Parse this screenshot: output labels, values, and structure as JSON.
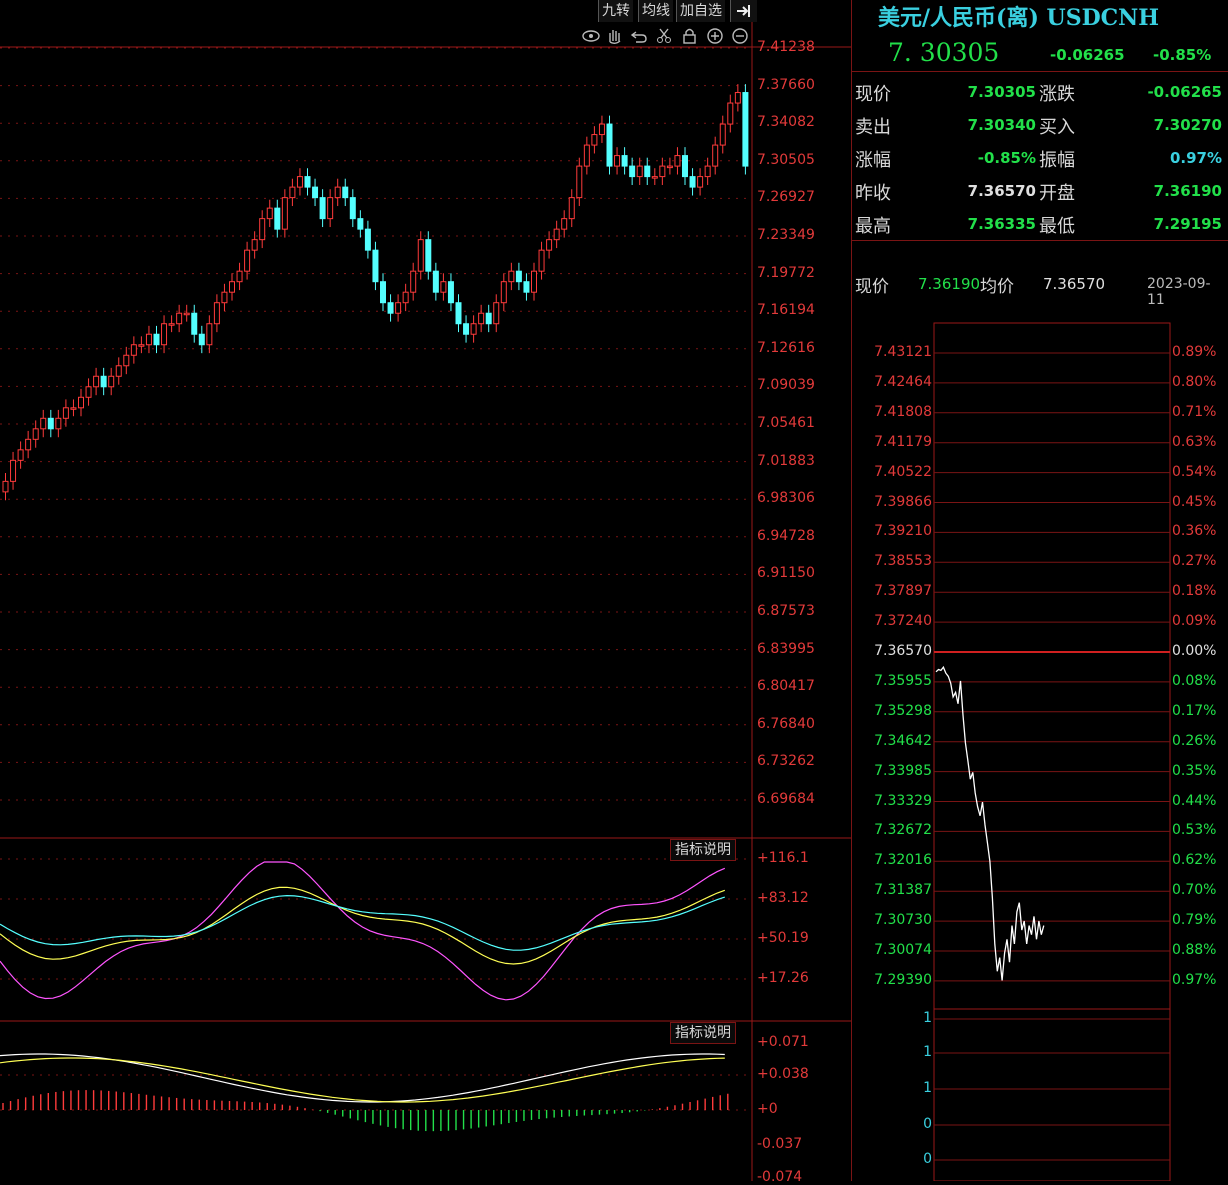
{
  "toolbar": {
    "buttons": [
      "九转",
      "均线",
      "加自选"
    ],
    "collapse_icon": "collapse-arrow-icon",
    "tool_icons": [
      "eye-icon",
      "hand-icon",
      "undo-icon",
      "scissors-icon",
      "lock-icon",
      "zoom-in-icon",
      "zoom-out-icon"
    ]
  },
  "kline": {
    "price_axis": [
      "7.41238",
      "7.37660",
      "7.34082",
      "7.30505",
      "7.26927",
      "7.23349",
      "7.19772",
      "7.16194",
      "7.12616",
      "7.09039",
      "7.05461",
      "7.01883",
      "6.98306",
      "6.94728",
      "6.91150",
      "6.87573",
      "6.83995",
      "6.80417",
      "6.76840",
      "6.73262",
      "6.69684"
    ],
    "up_color": "#ff3b3b",
    "down_color": "#54ffff"
  },
  "kdj": {
    "tag": "指标说明",
    "axis": [
      "+116.1",
      "+83.12",
      "+50.19",
      "+17.26"
    ],
    "colors": {
      "k": "#ffffff",
      "d": "#ffff55",
      "j": "#ff55ff",
      "extra": "#55ffff"
    }
  },
  "macd": {
    "tag": "指标说明",
    "axis": [
      "+0.071",
      "+0.038",
      "+0",
      "-0.037",
      "-0.074"
    ]
  },
  "quote": {
    "title": "美元/人民币(离) USDCNH",
    "price": "7. 30305",
    "change": "-0.06265",
    "change_pct": "-0.85%",
    "rows": [
      {
        "l1": "现价",
        "v1": "7.30305",
        "c1": "#22e04a",
        "l2": "涨跌",
        "v2": "-0.06265",
        "c2": "#22e04a"
      },
      {
        "l1": "卖出",
        "v1": "7.30340",
        "c1": "#22e04a",
        "l2": "买入",
        "v2": "7.30270",
        "c2": "#22e04a"
      },
      {
        "l1": "涨幅",
        "v1": "-0.85%",
        "c1": "#22e04a",
        "l2": "振幅",
        "v2": "0.97%",
        "c2": "#3ad0e0"
      },
      {
        "l1": "昨收",
        "v1": "7.36570",
        "c1": "#e0e0e0",
        "l2": "开盘",
        "v2": "7.36190",
        "c2": "#22e04a"
      },
      {
        "l1": "最高",
        "v1": "7.36335",
        "c1": "#22e04a",
        "l2": "最低",
        "v2": "7.29195",
        "c2": "#22e04a"
      }
    ]
  },
  "timeline": {
    "cur_label": "现价",
    "cur_value": "7.36190",
    "avg_label": "均价",
    "avg_value": "7.36570",
    "date": "2023-09-11",
    "left_axis": [
      "7.43121",
      "7.42464",
      "7.41808",
      "7.41179",
      "7.40522",
      "7.39866",
      "7.39210",
      "7.38553",
      "7.37897",
      "7.37240",
      "7.36570",
      "7.35955",
      "7.35298",
      "7.34642",
      "7.33985",
      "7.33329",
      "7.32672",
      "7.32016",
      "7.31387",
      "7.30730",
      "7.30074",
      "7.29390"
    ],
    "right_axis": [
      "0.89%",
      "0.80%",
      "0.71%",
      "0.63%",
      "0.54%",
      "0.45%",
      "0.36%",
      "0.27%",
      "0.18%",
      "0.09%",
      "0.00%",
      "0.08%",
      "0.17%",
      "0.26%",
      "0.35%",
      "0.44%",
      "0.53%",
      "0.62%",
      "0.70%",
      "0.79%",
      "0.88%",
      "0.97%"
    ],
    "volume_axis": [
      "1",
      "1",
      "1",
      "0",
      "0"
    ]
  }
}
